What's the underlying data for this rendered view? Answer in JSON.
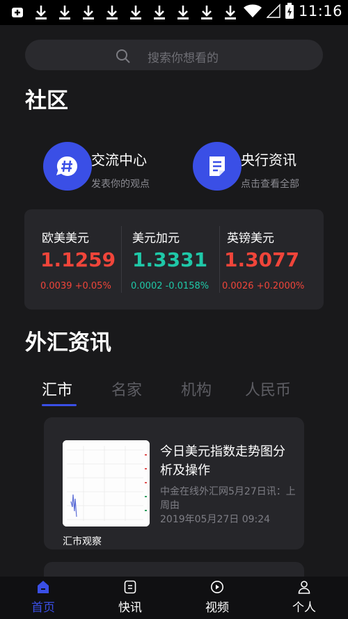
{
  "status_bar": {
    "time": "11:16"
  },
  "search": {
    "placeholder": "搜索你想看的"
  },
  "community": {
    "title": "社区",
    "items": [
      {
        "icon": "hash-icon",
        "title": "交流中心",
        "subtitle": "发表你的观点"
      },
      {
        "icon": "document-icon",
        "title": "央行资讯",
        "subtitle": "点击查看全部"
      }
    ]
  },
  "rates": [
    {
      "name": "欧美美元",
      "value": "1.1259",
      "change": "0.0039 +0.05%",
      "color": "#f0453a"
    },
    {
      "name": "美元加元",
      "value": "1.3331",
      "change": "0.0002 -0.0158%",
      "color": "#1fc8a8"
    },
    {
      "name": "英镑美元",
      "value": "1.3077",
      "change": "0.0026 +0.2000%",
      "color": "#f0453a"
    }
  ],
  "news_section": {
    "title": "外汇资讯",
    "tabs": [
      "汇市",
      "名家",
      "机构",
      "人民币"
    ],
    "active_tab": "汇市"
  },
  "news": [
    {
      "title": "今日美元指数走势图分析及操作",
      "source": "中金在线外汇网5月27日讯：上周由",
      "date": "2019年05月27日 09:24",
      "category": "汇市观察"
    }
  ],
  "bottom_nav": [
    {
      "label": "首页",
      "icon": "home-icon",
      "active": true
    },
    {
      "label": "快讯",
      "icon": "flash-news-icon",
      "active": false
    },
    {
      "label": "视频",
      "icon": "play-icon",
      "active": false
    },
    {
      "label": "个人",
      "icon": "person-icon",
      "active": false
    }
  ],
  "colors": {
    "accent": "#3a4fe6",
    "up": "#f0453a",
    "down": "#1fc8a8",
    "background": "#19191b"
  }
}
